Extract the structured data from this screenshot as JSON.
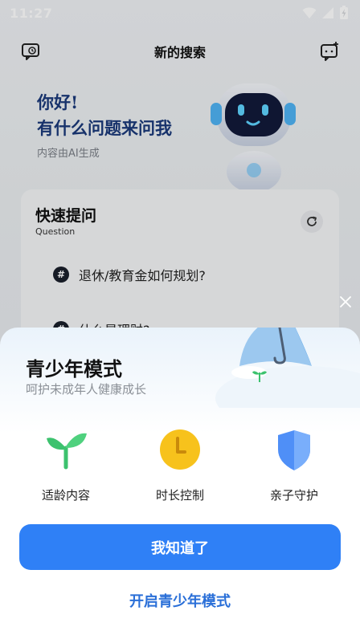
{
  "status_bar": {
    "time": "11:27",
    "icons": [
      "wifi-icon",
      "signal-icon",
      "battery-charging-icon"
    ]
  },
  "header": {
    "title": "新的搜索",
    "left_icon": "chat-history-icon",
    "right_icon": "new-chat-icon"
  },
  "greeting": {
    "line1": "你好!",
    "line2": "有什么问题来问我",
    "note": "内容由AI生成"
  },
  "quick_questions": {
    "title": "快速提问",
    "subtitle": "Question",
    "refresh_icon": "refresh-icon",
    "items": [
      {
        "icon": "#",
        "text": "退休/教育金如何规划?"
      },
      {
        "icon": "#",
        "text": "什么是理财?"
      }
    ]
  },
  "youth_sheet": {
    "title": "青少年模式",
    "subtitle": "呵护未成年人健康成长",
    "features": [
      {
        "label": "适龄内容",
        "icon": "sprout-icon"
      },
      {
        "label": "时长控制",
        "icon": "clock-icon"
      },
      {
        "label": "亲子守护",
        "icon": "shield-icon"
      }
    ],
    "primary_button": "我知道了",
    "secondary_link": "开启青少年模式"
  },
  "colors": {
    "accent": "#2f80f6",
    "link": "#2a6fd8",
    "greeting": "#1b3a7a",
    "clock": "#f7c21c",
    "shield": "#4f8ff7",
    "sprout": "#3cc26e"
  }
}
